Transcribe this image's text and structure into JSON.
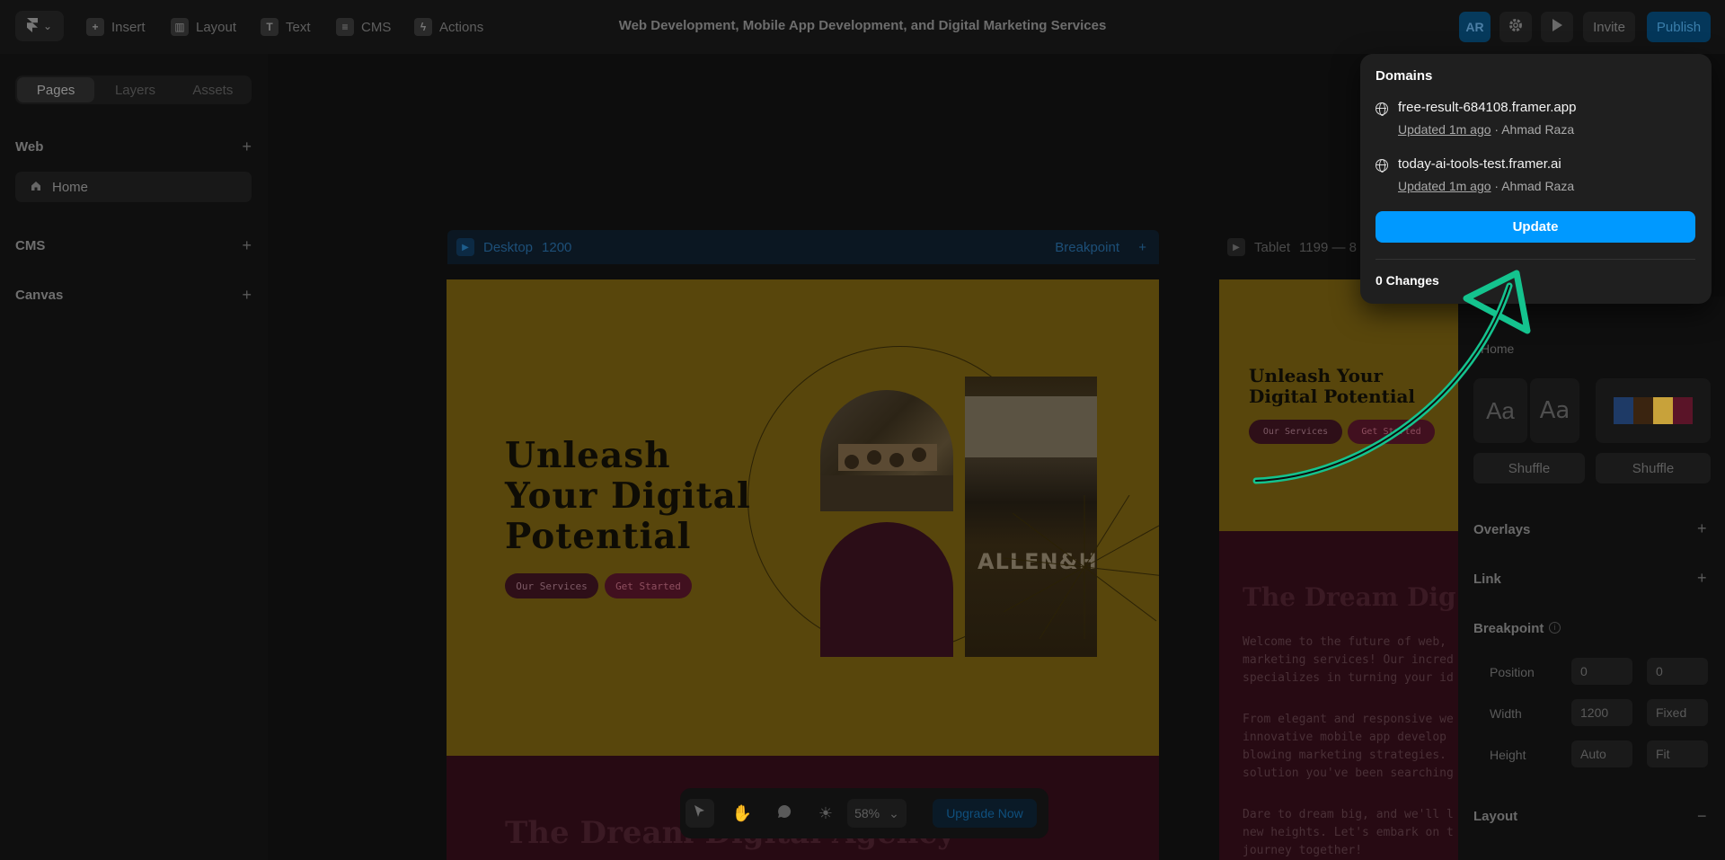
{
  "topbar": {
    "logo_chevron": "⌄",
    "tools": [
      {
        "label": "Insert",
        "icon": "plus-icon",
        "glyph": "+"
      },
      {
        "label": "Layout",
        "icon": "layout-icon",
        "glyph": "▥"
      },
      {
        "label": "Text",
        "icon": "text-icon",
        "glyph": "T"
      },
      {
        "label": "CMS",
        "icon": "database-icon",
        "glyph": "≡"
      },
      {
        "label": "Actions",
        "icon": "bolt-icon",
        "glyph": "ϟ"
      }
    ],
    "title": "Web Development, Mobile App Development, and Digital Marketing Services",
    "avatar": "AR",
    "invite_label": "Invite",
    "publish_label": "Publish"
  },
  "sidebar": {
    "tabs": [
      "Pages",
      "Layers",
      "Assets"
    ],
    "active_tab": "Pages",
    "sections": {
      "web": "Web",
      "cms": "CMS",
      "canvas": "Canvas"
    },
    "pages": [
      {
        "label": "Home"
      }
    ]
  },
  "canvas": {
    "desktop": {
      "name": "Desktop",
      "width": "1200",
      "breakpoint": "Breakpoint"
    },
    "tablet": {
      "name": "Tablet",
      "width": "1199 — 8"
    },
    "hero": {
      "title": "Unleash Your Digital Potential",
      "btn_services": "Our Services",
      "btn_started": "Get Started",
      "photo_text": "ALLEN&H"
    },
    "dream": {
      "title": "The Dream Digital Agency"
    },
    "tablet_hero": {
      "title": "Unleash Your Digital Potential",
      "btn_services": "Our Services",
      "btn_started": "Get Started"
    },
    "tablet_dream": {
      "title": "The Dream Dig",
      "para1": [
        "Welcome to the future of web,",
        "marketing services! Our incred",
        "specializes in turning your id"
      ],
      "para2": [
        "From elegant and responsive we",
        "innovative mobile app develop",
        "blowing marketing strategies.",
        "solution you've been searching"
      ],
      "para3": [
        "Dare to dream big, and we'll l",
        "new heights. Let's embark on t",
        "journey together!"
      ]
    }
  },
  "panel": {
    "page_name": "Home",
    "font_sample_1": "Aa",
    "font_sample_2": "Aa",
    "shuffle_1": "Shuffle",
    "shuffle_2": "Shuffle",
    "overlays": "Overlays",
    "link": "Link",
    "breakpoint": "Breakpoint",
    "position_label": "Position",
    "position_x": "0",
    "position_y": "0",
    "width_label": "Width",
    "width_value": "1200",
    "width_mode": "Fixed",
    "height_label": "Height",
    "height_value": "Auto",
    "height_mode": "Fit",
    "layout": "Layout",
    "palette": [
      "#1e3a66",
      "#3a2410",
      "#c8a23a",
      "#5a1428"
    ]
  },
  "popover": {
    "title": "Domains",
    "domains": [
      {
        "name": "free-result-684108.framer.app",
        "updated": "Updated 1m ago",
        "author": "Ahmad Raza"
      },
      {
        "name": "today-ai-tools-test.framer.ai",
        "updated": "Updated 1m ago",
        "author": "Ahmad Raza"
      }
    ],
    "separator": " · ",
    "update_label": "Update",
    "changes": "0 Changes"
  },
  "bottombar": {
    "zoom": "58%",
    "upgrade_label": "Upgrade Now"
  },
  "colors": {
    "accent": "#0099ff",
    "arrow": "#14c38e",
    "hero_bg": "#58460c",
    "dream_bg": "#270a13"
  }
}
